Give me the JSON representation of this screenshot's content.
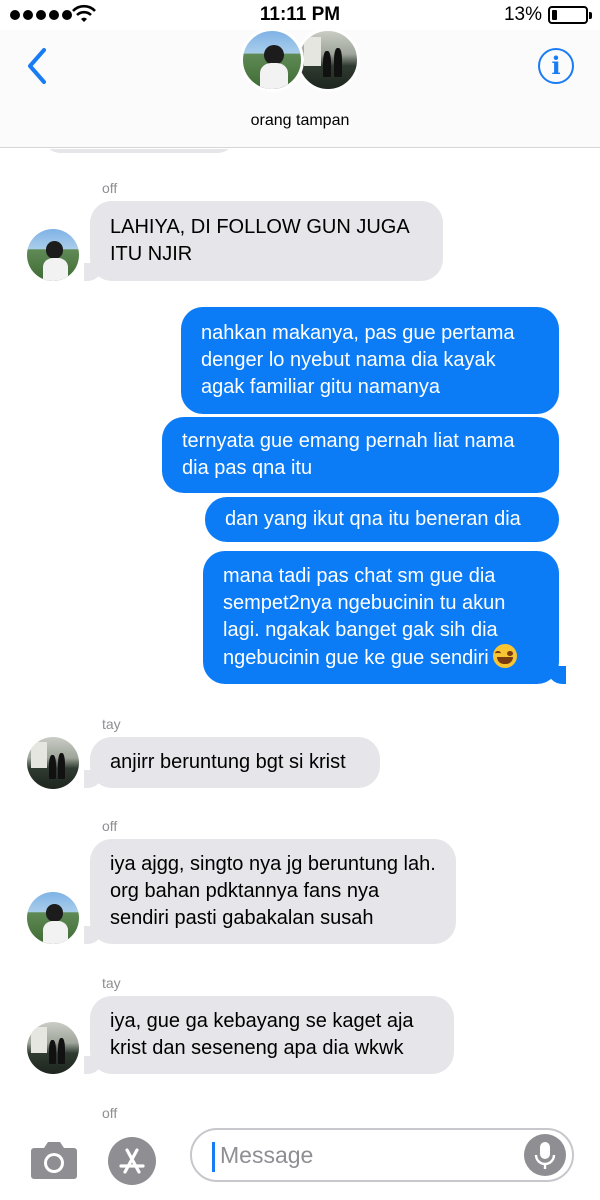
{
  "status_bar": {
    "time": "11:11 PM",
    "battery_percent": "13%"
  },
  "header": {
    "group_name": "orang tampan",
    "back_icon": "chevron-left-icon",
    "info_icon": "info-icon",
    "info_glyph": "i"
  },
  "messages": [
    {
      "sender": "off",
      "text": "LAHIYA, DI FOLLOW GUN JUGA ITU NJIR",
      "direction": "incoming"
    },
    {
      "text": "nahkan makanya, pas gue pertama denger lo nyebut nama dia kayak agak familiar gitu namanya",
      "direction": "outgoing"
    },
    {
      "text": "ternyata gue emang pernah liat nama dia pas qna itu",
      "direction": "outgoing"
    },
    {
      "text": "dan yang ikut qna itu beneran dia",
      "direction": "outgoing"
    },
    {
      "text": "mana tadi pas chat sm gue dia sempet2nya ngebucinin tu akun lagi. ngakak banget gak sih dia ngebucinin gue ke gue sendiri",
      "direction": "outgoing",
      "emoji": "tears-of-joy"
    },
    {
      "sender": "tay",
      "text": "anjirr beruntung bgt si krist",
      "direction": "incoming"
    },
    {
      "sender": "off",
      "text": "iya ajgg, singto nya jg beruntung lah. org bahan pdktannya fans nya sendiri pasti gabakalan susah",
      "direction": "incoming"
    },
    {
      "sender": "tay",
      "text": "iya, gue ga kebayang se kaget aja krist dan seseneng apa dia wkwk",
      "direction": "incoming"
    },
    {
      "sender": "off",
      "text": "",
      "direction": "incoming"
    }
  ],
  "input_bar": {
    "placeholder": "Message",
    "camera_icon": "camera-icon",
    "apps_icon": "app-store-icon",
    "mic_icon": "microphone-icon"
  },
  "colors": {
    "accent": "#1a7cf5",
    "outgoing_bubble": "#0b7cf6",
    "incoming_bubble": "#e5e5ea"
  }
}
